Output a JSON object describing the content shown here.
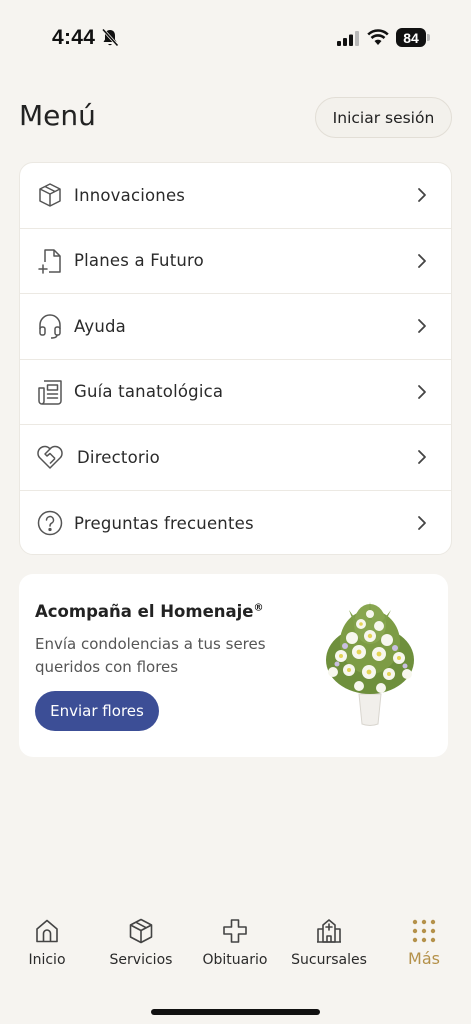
{
  "status_bar": {
    "time": "4:44",
    "battery": "84"
  },
  "header": {
    "title": "Menú",
    "login_label": "Iniciar sesión"
  },
  "menu": {
    "items": [
      {
        "label": "Innovaciones",
        "icon": "box-icon"
      },
      {
        "label": "Planes a Futuro",
        "icon": "document-add-icon"
      },
      {
        "label": "Ayuda",
        "icon": "headphones-icon"
      },
      {
        "label": "Guía tanatológica",
        "icon": "newspaper-icon"
      },
      {
        "label": "Directorio",
        "icon": "heart-handshake-icon"
      },
      {
        "label": "Preguntas frecuentes",
        "icon": "question-circle-icon"
      }
    ]
  },
  "promo": {
    "title": "Acompaña el Homenaje",
    "title_mark": "®",
    "text": "Envía condolencias a tus seres queridos con flores",
    "button_label": "Enviar flores"
  },
  "tabs": [
    {
      "label": "Inicio",
      "icon": "home-icon"
    },
    {
      "label": "Servicios",
      "icon": "box-icon"
    },
    {
      "label": "Obituario",
      "icon": "cross-icon"
    },
    {
      "label": "Sucursales",
      "icon": "building-icon"
    },
    {
      "label": "Más",
      "icon": "grid-dots-icon"
    }
  ],
  "colors": {
    "background": "#f6f4f0",
    "accent_gold": "#b4914a",
    "button_blue": "#3c4e96"
  }
}
